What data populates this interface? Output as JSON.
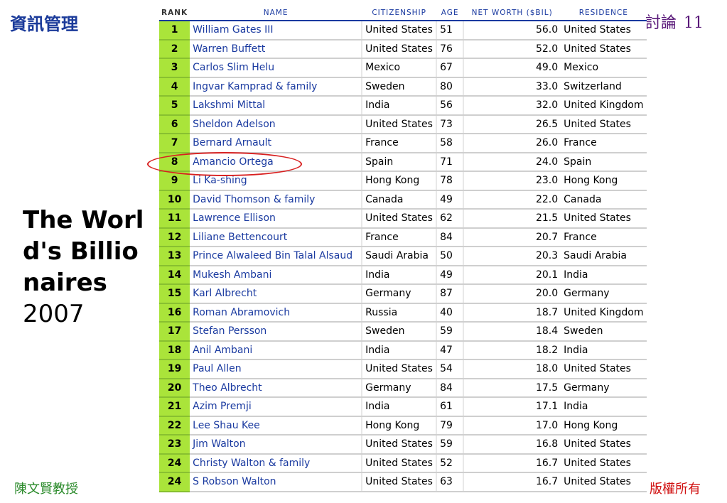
{
  "header": {
    "left": "資訊管理",
    "right_text": "討論",
    "page_number": "11"
  },
  "footer": {
    "left": "陳文賢教授",
    "right": "版權所有"
  },
  "slide_title": {
    "line1": "The World's Billionaires",
    "line2": "2007"
  },
  "table": {
    "columns": {
      "rank": "RANK",
      "name": "NAME",
      "citizenship": "CITIZENSHIP",
      "age": "AGE",
      "net_worth": "NET WORTH ($BIL)",
      "residence": "RESIDENCE"
    },
    "rows": [
      {
        "rank": "1",
        "name": "William Gates III",
        "citizenship": "United States",
        "age": "51",
        "net_worth": "56.0",
        "residence": "United States"
      },
      {
        "rank": "2",
        "name": "Warren Buffett",
        "citizenship": "United States",
        "age": "76",
        "net_worth": "52.0",
        "residence": "United States"
      },
      {
        "rank": "3",
        "name": "Carlos Slim Helu",
        "citizenship": "Mexico",
        "age": "67",
        "net_worth": "49.0",
        "residence": "Mexico"
      },
      {
        "rank": "4",
        "name": "Ingvar Kamprad & family",
        "citizenship": "Sweden",
        "age": "80",
        "net_worth": "33.0",
        "residence": "Switzerland"
      },
      {
        "rank": "5",
        "name": "Lakshmi Mittal",
        "citizenship": "India",
        "age": "56",
        "net_worth": "32.0",
        "residence": "United Kingdom"
      },
      {
        "rank": "6",
        "name": "Sheldon Adelson",
        "citizenship": "United States",
        "age": "73",
        "net_worth": "26.5",
        "residence": "United States"
      },
      {
        "rank": "7",
        "name": "Bernard Arnault",
        "citizenship": "France",
        "age": "58",
        "net_worth": "26.0",
        "residence": "France"
      },
      {
        "rank": "8",
        "name": "Amancio Ortega",
        "citizenship": "Spain",
        "age": "71",
        "net_worth": "24.0",
        "residence": "Spain"
      },
      {
        "rank": "9",
        "name": "Li Ka-shing",
        "citizenship": "Hong Kong",
        "age": "78",
        "net_worth": "23.0",
        "residence": "Hong Kong"
      },
      {
        "rank": "10",
        "name": "David Thomson & family",
        "citizenship": "Canada",
        "age": "49",
        "net_worth": "22.0",
        "residence": "Canada"
      },
      {
        "rank": "11",
        "name": "Lawrence Ellison",
        "citizenship": "United States",
        "age": "62",
        "net_worth": "21.5",
        "residence": "United States"
      },
      {
        "rank": "12",
        "name": "Liliane Bettencourt",
        "citizenship": "France",
        "age": "84",
        "net_worth": "20.7",
        "residence": "France"
      },
      {
        "rank": "13",
        "name": "Prince Alwaleed Bin Talal Alsaud",
        "citizenship": "Saudi Arabia",
        "age": "50",
        "net_worth": "20.3",
        "residence": "Saudi Arabia"
      },
      {
        "rank": "14",
        "name": "Mukesh Ambani",
        "citizenship": "India",
        "age": "49",
        "net_worth": "20.1",
        "residence": "India"
      },
      {
        "rank": "15",
        "name": "Karl Albrecht",
        "citizenship": "Germany",
        "age": "87",
        "net_worth": "20.0",
        "residence": "Germany"
      },
      {
        "rank": "16",
        "name": "Roman Abramovich",
        "citizenship": "Russia",
        "age": "40",
        "net_worth": "18.7",
        "residence": "United Kingdom"
      },
      {
        "rank": "17",
        "name": "Stefan Persson",
        "citizenship": "Sweden",
        "age": "59",
        "net_worth": "18.4",
        "residence": "Sweden"
      },
      {
        "rank": "18",
        "name": "Anil Ambani",
        "citizenship": "India",
        "age": "47",
        "net_worth": "18.2",
        "residence": "India"
      },
      {
        "rank": "19",
        "name": "Paul Allen",
        "citizenship": "United States",
        "age": "54",
        "net_worth": "18.0",
        "residence": "United States"
      },
      {
        "rank": "20",
        "name": "Theo Albrecht",
        "citizenship": "Germany",
        "age": "84",
        "net_worth": "17.5",
        "residence": "Germany"
      },
      {
        "rank": "21",
        "name": "Azim Premji",
        "citizenship": "India",
        "age": "61",
        "net_worth": "17.1",
        "residence": "India"
      },
      {
        "rank": "22",
        "name": "Lee Shau Kee",
        "citizenship": "Hong Kong",
        "age": "79",
        "net_worth": "17.0",
        "residence": "Hong Kong"
      },
      {
        "rank": "23",
        "name": "Jim Walton",
        "citizenship": "United States",
        "age": "59",
        "net_worth": "16.8",
        "residence": "United States"
      },
      {
        "rank": "24",
        "name": "Christy Walton & family",
        "citizenship": "United States",
        "age": "52",
        "net_worth": "16.7",
        "residence": "United States"
      },
      {
        "rank": "24",
        "name": "S Robson Walton",
        "citizenship": "United States",
        "age": "63",
        "net_worth": "16.7",
        "residence": "United States"
      }
    ]
  },
  "colors": {
    "rank_green": "#aae43a",
    "name_blue": "#1a3aa0",
    "highlight_red": "#d82020"
  }
}
